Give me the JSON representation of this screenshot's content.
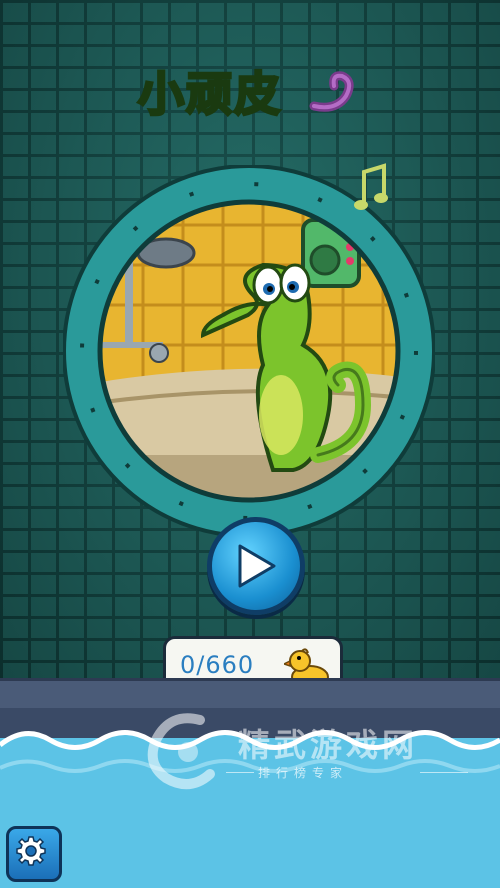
{
  "game": {
    "title": "小顽皮",
    "score_display": "0/660",
    "collectible_icon": "rubber-duck-icon",
    "play_icon": "play-icon",
    "settings_icon": "gear-icon"
  },
  "watermark": {
    "brand": "精武游戏网",
    "tagline": "排行榜专家"
  },
  "colors": {
    "wall": "#1d5e5a",
    "water": "#5cc3e6",
    "play_button": "#1a8fd0",
    "title_green": "#9bd23a"
  }
}
